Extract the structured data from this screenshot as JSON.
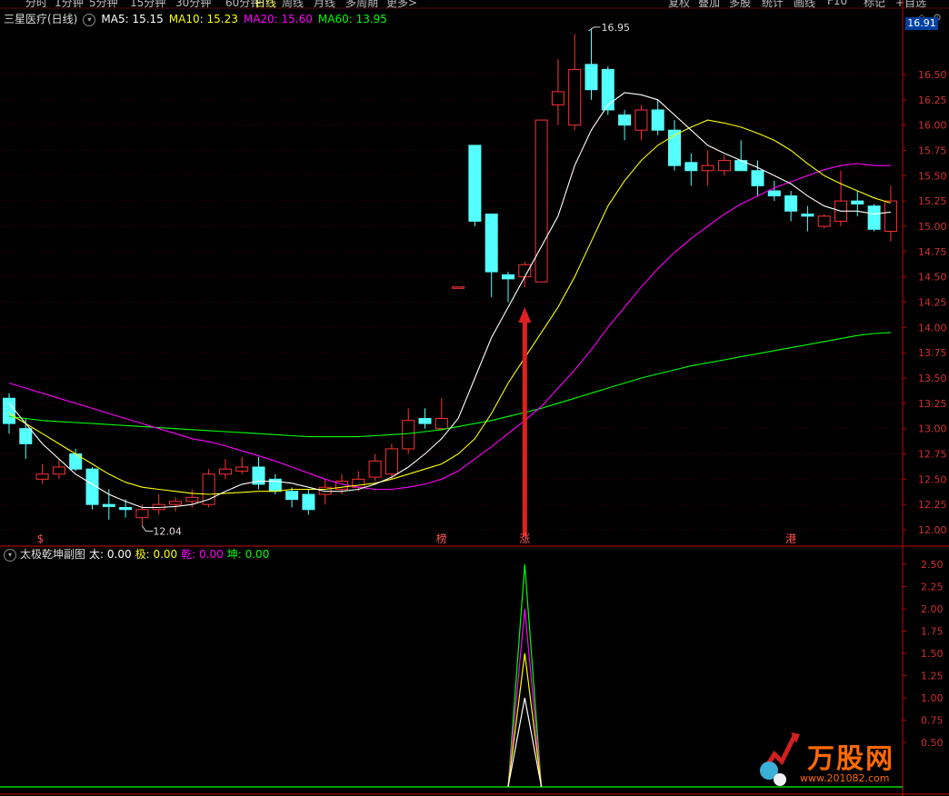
{
  "toolbar": {
    "left_items": [
      "分时",
      "1分钟",
      "5分钟",
      "15分钟",
      "30分钟",
      "60分钟",
      "日线",
      "周线",
      "月线",
      "多周期",
      "更多>"
    ],
    "right_items": [
      "复权",
      "叠加",
      "多股",
      "统计",
      "画线",
      "F10",
      "标记",
      "+自选"
    ]
  },
  "header": {
    "stock_name": "三星医疗(日线)",
    "ma5": "MA5: 15.15",
    "ma10": "MA10: 15.23",
    "ma20": "MA20: 15.60",
    "ma60": "MA60: 13.95"
  },
  "current_price": "16.91",
  "sub_header": {
    "title": "太极乾坤副图",
    "tai": "太: 0.00",
    "ji": "极: 0.00",
    "qian": "乾: 0.00",
    "kun": "坤: 0.00"
  },
  "markers": [
    "$",
    "榜",
    "涨",
    "港"
  ],
  "annotations": {
    "high": "16.95",
    "low": "12.04"
  },
  "brand": {
    "name": "万股网",
    "url": "www.201082.com"
  },
  "colors": {
    "up": "#ff3232",
    "down": "#54ffff",
    "ma5": "#ffffff",
    "ma10": "#ffff00",
    "ma20": "#ff00ff",
    "ma60": "#00ff00",
    "axis": "#cc0000",
    "arrow": "#e02020"
  },
  "chart_data": [
    {
      "type": "candlestick",
      "title": "三星医疗(日线)",
      "ylim": [
        11.9,
        16.95
      ],
      "yticks": [
        12.0,
        12.25,
        12.5,
        12.75,
        13.0,
        13.25,
        13.5,
        13.75,
        14.0,
        14.25,
        14.5,
        14.75,
        15.0,
        15.25,
        15.5,
        15.75,
        16.0,
        16.25,
        16.5
      ],
      "candles": [
        {
          "o": 13.3,
          "h": 13.35,
          "l": 12.95,
          "c": 13.05
        },
        {
          "o": 13.0,
          "h": 13.1,
          "l": 12.7,
          "c": 12.85
        },
        {
          "o": 12.5,
          "h": 12.65,
          "l": 12.45,
          "c": 12.55
        },
        {
          "o": 12.55,
          "h": 12.7,
          "l": 12.5,
          "c": 12.62
        },
        {
          "o": 12.75,
          "h": 12.8,
          "l": 12.58,
          "c": 12.6
        },
        {
          "o": 12.6,
          "h": 12.62,
          "l": 12.2,
          "c": 12.25
        },
        {
          "o": 12.25,
          "h": 12.4,
          "l": 12.1,
          "c": 12.23
        },
        {
          "o": 12.22,
          "h": 12.3,
          "l": 12.12,
          "c": 12.2
        },
        {
          "o": 12.12,
          "h": 12.25,
          "l": 12.04,
          "c": 12.2
        },
        {
          "o": 12.2,
          "h": 12.35,
          "l": 12.15,
          "c": 12.25
        },
        {
          "o": 12.25,
          "h": 12.32,
          "l": 12.18,
          "c": 12.28
        },
        {
          "o": 12.28,
          "h": 12.4,
          "l": 12.22,
          "c": 12.32
        },
        {
          "o": 12.25,
          "h": 12.6,
          "l": 12.22,
          "c": 12.55
        },
        {
          "o": 12.55,
          "h": 12.7,
          "l": 12.5,
          "c": 12.6
        },
        {
          "o": 12.58,
          "h": 12.72,
          "l": 12.55,
          "c": 12.62
        },
        {
          "o": 12.62,
          "h": 12.72,
          "l": 12.4,
          "c": 12.45
        },
        {
          "o": 12.5,
          "h": 12.55,
          "l": 12.35,
          "c": 12.38
        },
        {
          "o": 12.38,
          "h": 12.42,
          "l": 12.22,
          "c": 12.3
        },
        {
          "o": 12.35,
          "h": 12.4,
          "l": 12.15,
          "c": 12.2
        },
        {
          "o": 12.35,
          "h": 12.5,
          "l": 12.25,
          "c": 12.42
        },
        {
          "o": 12.4,
          "h": 12.55,
          "l": 12.35,
          "c": 12.48
        },
        {
          "o": 12.42,
          "h": 12.58,
          "l": 12.38,
          "c": 12.5
        },
        {
          "o": 12.52,
          "h": 12.75,
          "l": 12.48,
          "c": 12.68
        },
        {
          "o": 12.55,
          "h": 12.85,
          "l": 12.5,
          "c": 12.8
        },
        {
          "o": 12.8,
          "h": 13.2,
          "l": 12.75,
          "c": 13.08
        },
        {
          "o": 13.1,
          "h": 13.2,
          "l": 13.0,
          "c": 13.05
        },
        {
          "o": 13.0,
          "h": 13.3,
          "l": 12.98,
          "c": 13.1
        },
        {
          "o": 14.4,
          "h": 14.4,
          "l": 14.4,
          "c": 14.4
        },
        {
          "o": 15.8,
          "h": 15.8,
          "l": 15.0,
          "c": 15.05
        },
        {
          "o": 15.12,
          "h": 15.12,
          "l": 14.3,
          "c": 14.55
        },
        {
          "o": 14.52,
          "h": 14.55,
          "l": 14.25,
          "c": 14.48
        },
        {
          "o": 14.5,
          "h": 14.65,
          "l": 14.4,
          "c": 14.62
        },
        {
          "o": 14.45,
          "h": 16.05,
          "l": 14.45,
          "c": 16.05
        },
        {
          "o": 16.2,
          "h": 16.65,
          "l": 16.0,
          "c": 16.33
        },
        {
          "o": 16.0,
          "h": 16.9,
          "l": 15.95,
          "c": 16.55
        },
        {
          "o": 16.6,
          "h": 16.95,
          "l": 16.25,
          "c": 16.35
        },
        {
          "o": 16.55,
          "h": 16.58,
          "l": 16.1,
          "c": 16.15
        },
        {
          "o": 16.1,
          "h": 16.15,
          "l": 15.85,
          "c": 16.0
        },
        {
          "o": 15.95,
          "h": 16.2,
          "l": 15.85,
          "c": 16.15
        },
        {
          "o": 16.15,
          "h": 16.25,
          "l": 15.9,
          "c": 15.95
        },
        {
          "o": 15.95,
          "h": 16.05,
          "l": 15.55,
          "c": 15.6
        },
        {
          "o": 15.63,
          "h": 15.72,
          "l": 15.4,
          "c": 15.55
        },
        {
          "o": 15.55,
          "h": 15.75,
          "l": 15.4,
          "c": 15.6
        },
        {
          "o": 15.55,
          "h": 15.7,
          "l": 15.5,
          "c": 15.65
        },
        {
          "o": 15.65,
          "h": 15.85,
          "l": 15.55,
          "c": 15.55
        },
        {
          "o": 15.55,
          "h": 15.65,
          "l": 15.3,
          "c": 15.4
        },
        {
          "o": 15.35,
          "h": 15.45,
          "l": 15.25,
          "c": 15.3
        },
        {
          "o": 15.3,
          "h": 15.35,
          "l": 15.05,
          "c": 15.15
        },
        {
          "o": 15.12,
          "h": 15.2,
          "l": 14.95,
          "c": 15.1
        },
        {
          "o": 15.0,
          "h": 15.12,
          "l": 14.98,
          "c": 15.1
        },
        {
          "o": 15.05,
          "h": 15.55,
          "l": 15.0,
          "c": 15.25
        },
        {
          "o": 15.25,
          "h": 15.35,
          "l": 15.1,
          "c": 15.22
        },
        {
          "o": 15.2,
          "h": 15.22,
          "l": 14.95,
          "c": 14.97
        },
        {
          "o": 14.95,
          "h": 15.4,
          "l": 14.85,
          "c": 15.25
        }
      ],
      "ma5": [
        13.25,
        13.05,
        12.85,
        12.7,
        12.55,
        12.45,
        12.35,
        12.28,
        12.22,
        12.22,
        12.23,
        12.25,
        12.3,
        12.38,
        12.45,
        12.48,
        12.48,
        12.46,
        12.42,
        12.38,
        12.38,
        12.4,
        12.45,
        12.52,
        12.62,
        12.75,
        12.9,
        13.1,
        13.5,
        13.9,
        14.2,
        14.5,
        14.8,
        15.1,
        15.6,
        15.95,
        16.2,
        16.32,
        16.3,
        16.25,
        16.1,
        15.95,
        15.8,
        15.72,
        15.65,
        15.58,
        15.5,
        15.42,
        15.3,
        15.2,
        15.15,
        15.15,
        15.12,
        15.14
      ],
      "ma10": [
        13.15,
        13.05,
        12.95,
        12.85,
        12.75,
        12.65,
        12.55,
        12.47,
        12.42,
        12.4,
        12.38,
        12.36,
        12.35,
        12.36,
        12.37,
        12.38,
        12.38,
        12.4,
        12.4,
        12.4,
        12.42,
        12.44,
        12.46,
        12.5,
        12.55,
        12.6,
        12.65,
        12.75,
        12.9,
        13.15,
        13.45,
        13.7,
        13.95,
        14.2,
        14.5,
        14.85,
        15.2,
        15.45,
        15.65,
        15.8,
        15.9,
        15.98,
        16.05,
        16.02,
        15.98,
        15.92,
        15.85,
        15.75,
        15.62,
        15.5,
        15.42,
        15.35,
        15.28,
        15.23
      ],
      "ma20": [
        13.45,
        13.4,
        13.35,
        13.3,
        13.25,
        13.2,
        13.15,
        13.1,
        13.05,
        13.0,
        12.95,
        12.9,
        12.87,
        12.83,
        12.78,
        12.73,
        12.68,
        12.62,
        12.56,
        12.5,
        12.45,
        12.42,
        12.4,
        12.4,
        12.42,
        12.45,
        12.5,
        12.58,
        12.7,
        12.82,
        12.95,
        13.08,
        13.22,
        13.4,
        13.58,
        13.78,
        14.0,
        14.2,
        14.4,
        14.58,
        14.74,
        14.88,
        15.0,
        15.12,
        15.22,
        15.3,
        15.38,
        15.44,
        15.5,
        15.56,
        15.6,
        15.62,
        15.6,
        15.6
      ],
      "ma60": [
        13.12,
        13.1,
        13.08,
        13.07,
        13.06,
        13.05,
        13.04,
        13.03,
        13.02,
        13.01,
        13.0,
        12.99,
        12.98,
        12.97,
        12.96,
        12.95,
        12.94,
        12.93,
        12.92,
        12.92,
        12.92,
        12.92,
        12.93,
        12.94,
        12.95,
        12.97,
        12.99,
        13.02,
        13.05,
        13.08,
        13.12,
        13.16,
        13.2,
        13.25,
        13.3,
        13.35,
        13.4,
        13.45,
        13.5,
        13.54,
        13.58,
        13.62,
        13.65,
        13.68,
        13.71,
        13.74,
        13.77,
        13.8,
        13.83,
        13.86,
        13.89,
        13.92,
        13.94,
        13.95
      ]
    },
    {
      "type": "line",
      "title": "太极乾坤副图",
      "ylim": [
        0,
        2.6
      ],
      "yticks": [
        0.5,
        0.75,
        1.0,
        1.25,
        1.5,
        1.75,
        2.0,
        2.25,
        2.5
      ],
      "spike_index": 31,
      "series": [
        {
          "name": "太",
          "color": "#ffffff",
          "peak": 1.0
        },
        {
          "name": "极",
          "color": "#ffff00",
          "peak": 1.5
        },
        {
          "name": "乾",
          "color": "#ff00ff",
          "peak": 2.0
        },
        {
          "name": "坤",
          "color": "#00ff00",
          "peak": 2.5
        }
      ]
    }
  ]
}
